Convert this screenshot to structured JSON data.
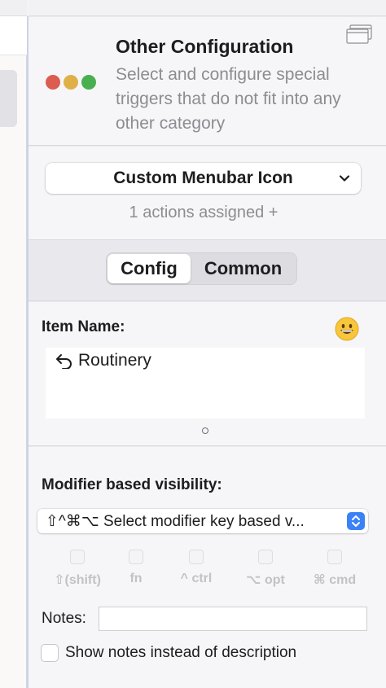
{
  "header": {
    "title": "Other Configuration",
    "description": "Select and configure special triggers that do not fit into any other category"
  },
  "trigger": {
    "selected": "Custom Menubar Icon",
    "actions_assigned": "1 actions assigned +"
  },
  "tabs": [
    {
      "label": "Config",
      "selected": true
    },
    {
      "label": "Common",
      "selected": false
    }
  ],
  "item": {
    "label": "Item Name:",
    "emoji_icon": "grinning-face",
    "value": "Routinery",
    "value_icon": "undo-arrow"
  },
  "modifier": {
    "label": "Modifier based visibility:",
    "select_value": "⇧^⌘⌥ Select modifier key based v...",
    "keys": [
      {
        "label": "⇧(shift)",
        "checked": false
      },
      {
        "label": "fn",
        "checked": false
      },
      {
        "label": "^ ctrl",
        "checked": false
      },
      {
        "label": "⌥ opt",
        "checked": false
      },
      {
        "label": "⌘ cmd",
        "checked": false
      }
    ]
  },
  "notes": {
    "label": "Notes:",
    "value": "",
    "show_instead_label": "Show notes instead of description",
    "show_instead_checked": false
  },
  "colors": {
    "traffic_red": "#dc5c50",
    "traffic_yellow": "#e0b048",
    "traffic_green": "#48b050",
    "accent_blue": "#3b82f6"
  }
}
